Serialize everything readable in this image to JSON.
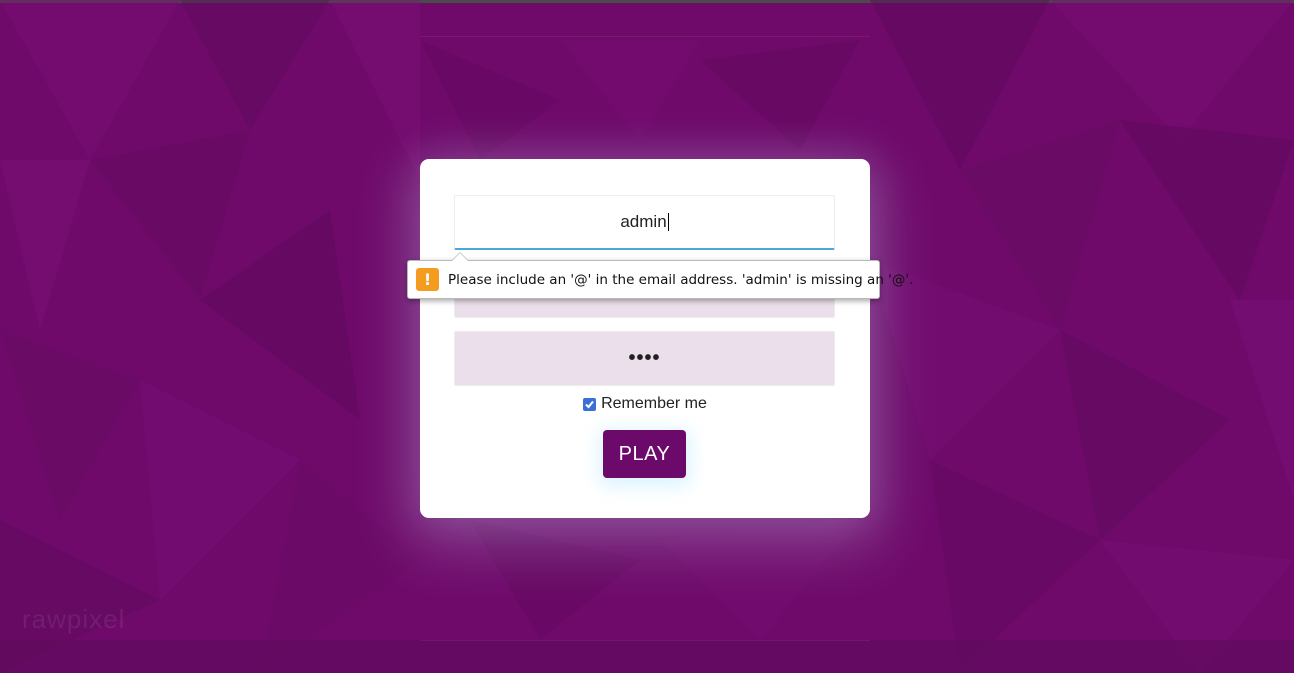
{
  "login_form": {
    "email_value": "admin",
    "password_masked": "••••",
    "remember_label": "Remember me",
    "remember_checked": true,
    "play_label": "PLAY"
  },
  "validation_tooltip": {
    "message": "Please include an '@' in the email address. 'admin' is missing an '@'.",
    "icon": "warning-icon",
    "icon_glyph": "!"
  },
  "watermark": {
    "text": "rawpixel"
  },
  "colors": {
    "background": "#6f0a6b",
    "card": "#ffffff",
    "input_fill": "#ebdfeb",
    "focus_underline": "#4aa8d8",
    "play_button": "#6b0a6b",
    "warning": "#f39c1f",
    "checkbox": "#3b6fd6"
  }
}
